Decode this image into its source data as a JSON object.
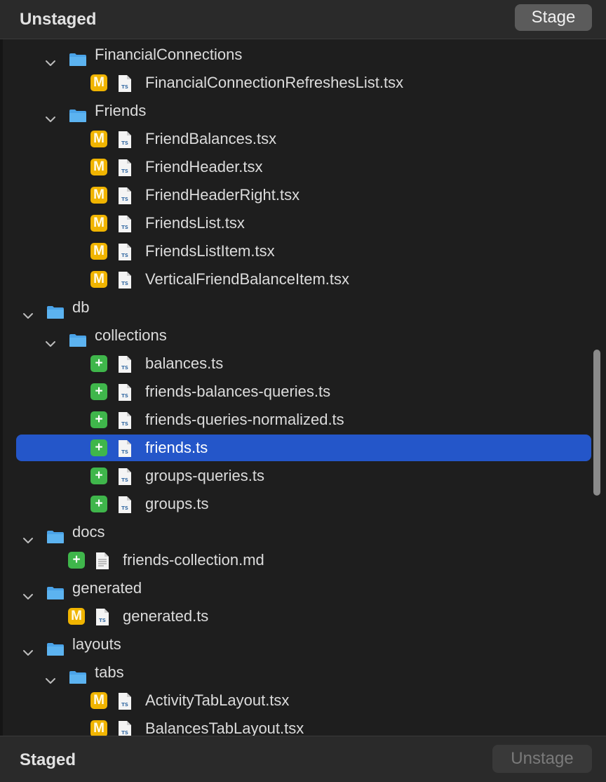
{
  "unstaged": {
    "title": "Unstaged",
    "stage_button": "Stage"
  },
  "staged": {
    "title": "Staged",
    "unstage_button": "Unstage"
  },
  "colors": {
    "selection": "#2456c9",
    "modified_badge": "#f0b400",
    "added_badge": "#3fb64b",
    "folder": "#4aa3e8"
  },
  "tree": [
    {
      "type": "folder",
      "depth": 1,
      "name": "FinancialConnections",
      "expanded": true
    },
    {
      "type": "file",
      "depth": 2,
      "name": "FinancialConnectionRefreshesList.tsx",
      "status": "M",
      "icon": "ts-file-icon"
    },
    {
      "type": "folder",
      "depth": 1,
      "name": "Friends",
      "expanded": true
    },
    {
      "type": "file",
      "depth": 2,
      "name": "FriendBalances.tsx",
      "status": "M",
      "icon": "ts-file-icon"
    },
    {
      "type": "file",
      "depth": 2,
      "name": "FriendHeader.tsx",
      "status": "M",
      "icon": "ts-file-icon"
    },
    {
      "type": "file",
      "depth": 2,
      "name": "FriendHeaderRight.tsx",
      "status": "M",
      "icon": "ts-file-icon"
    },
    {
      "type": "file",
      "depth": 2,
      "name": "FriendsList.tsx",
      "status": "M",
      "icon": "ts-file-icon"
    },
    {
      "type": "file",
      "depth": 2,
      "name": "FriendsListItem.tsx",
      "status": "M",
      "icon": "ts-file-icon"
    },
    {
      "type": "file",
      "depth": 2,
      "name": "VerticalFriendBalanceItem.tsx",
      "status": "M",
      "icon": "ts-file-icon"
    },
    {
      "type": "folder",
      "depth": 0,
      "name": "db",
      "expanded": true
    },
    {
      "type": "folder",
      "depth": 1,
      "name": "collections",
      "expanded": true
    },
    {
      "type": "file",
      "depth": 2,
      "name": "balances.ts",
      "status": "+",
      "icon": "ts-file-icon"
    },
    {
      "type": "file",
      "depth": 2,
      "name": "friends-balances-queries.ts",
      "status": "+",
      "icon": "ts-file-icon"
    },
    {
      "type": "file",
      "depth": 2,
      "name": "friends-queries-normalized.ts",
      "status": "+",
      "icon": "ts-file-icon"
    },
    {
      "type": "file",
      "depth": 2,
      "name": "friends.ts",
      "status": "+",
      "icon": "ts-file-icon",
      "selected": true
    },
    {
      "type": "file",
      "depth": 2,
      "name": "groups-queries.ts",
      "status": "+",
      "icon": "ts-file-icon"
    },
    {
      "type": "file",
      "depth": 2,
      "name": "groups.ts",
      "status": "+",
      "icon": "ts-file-icon"
    },
    {
      "type": "folder",
      "depth": 0,
      "name": "docs",
      "expanded": true
    },
    {
      "type": "file",
      "depth": 1,
      "name": "friends-collection.md",
      "status": "+",
      "icon": "text-file-icon"
    },
    {
      "type": "folder",
      "depth": 0,
      "name": "generated",
      "expanded": true
    },
    {
      "type": "file",
      "depth": 1,
      "name": "generated.ts",
      "status": "M",
      "icon": "ts-file-icon"
    },
    {
      "type": "folder",
      "depth": 0,
      "name": "layouts",
      "expanded": true
    },
    {
      "type": "folder",
      "depth": 1,
      "name": "tabs",
      "expanded": true
    },
    {
      "type": "file",
      "depth": 2,
      "name": "ActivityTabLayout.tsx",
      "status": "M",
      "icon": "ts-file-icon"
    },
    {
      "type": "file",
      "depth": 2,
      "name": "BalancesTabLayout.tsx",
      "status": "M",
      "icon": "ts-file-icon"
    }
  ]
}
